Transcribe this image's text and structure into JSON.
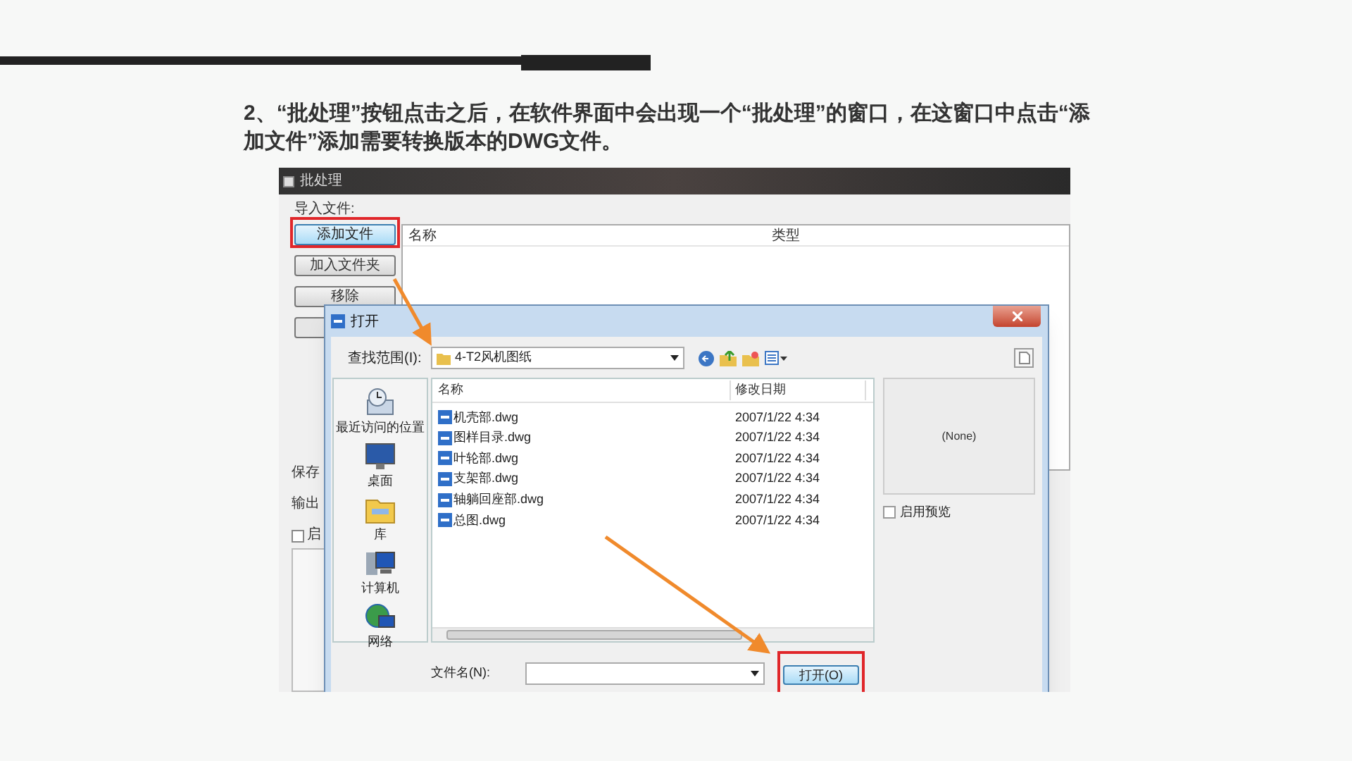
{
  "slide": {
    "instruction": "2、“批处理”按钮点击之后，在软件界面中会出现一个“批处理”的窗口，在这窗口中点击“添加文件”添加需要转换版本的DWG文件。"
  },
  "batch_window": {
    "title": "批处理",
    "import_label": "导入文件:",
    "buttons": [
      {
        "label": "添加文件",
        "focused": true,
        "annotated": true
      },
      {
        "label": "加入文件夹",
        "focused": false,
        "annotated": false
      },
      {
        "label": "移除",
        "focused": false,
        "annotated": false
      }
    ],
    "columns": [
      "名称",
      "类型"
    ],
    "side_labels": [
      "保存",
      "输出"
    ],
    "checkbox": {
      "label": "启",
      "checked": false
    }
  },
  "open_dialog": {
    "title": "打开",
    "look_in_label": "查找范围(I):",
    "look_in_value": "4-T2风机图纸",
    "places": [
      {
        "kind": "recent",
        "label": "最近访问的位置"
      },
      {
        "kind": "desktop",
        "label": "桌面"
      },
      {
        "kind": "library",
        "label": "库"
      },
      {
        "kind": "computer",
        "label": "计算机"
      },
      {
        "kind": "network",
        "label": "网络"
      }
    ],
    "columns": [
      "名称",
      "修改日期"
    ],
    "files": [
      {
        "name": "机壳部.dwg",
        "modified": "2007/1/22 4:34"
      },
      {
        "name": "图样目录.dwg",
        "modified": "2007/1/22 4:34"
      },
      {
        "name": "叶轮部.dwg",
        "modified": "2007/1/22 4:34"
      },
      {
        "name": "支架部.dwg",
        "modified": "2007/1/22 4:34"
      },
      {
        "name": "轴躺回座部.dwg",
        "modified": "2007/1/22 4:34"
      },
      {
        "name": "总图.dwg",
        "modified": "2007/1/22 4:34"
      }
    ],
    "preview_text": "(None)",
    "preview_checkbox": {
      "label": "启用预览",
      "checked": false
    },
    "filename_label": "文件名(N):",
    "open_button": {
      "label": "打开(O)",
      "annotated": true
    }
  }
}
